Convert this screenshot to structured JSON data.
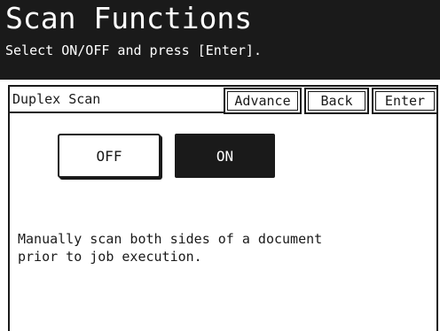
{
  "header": {
    "title": "Scan Functions",
    "subtitle": "Select ON/OFF and press [Enter]."
  },
  "panel": {
    "title": "Duplex Scan",
    "buttons": {
      "advance": "Advance",
      "back": "Back",
      "enter": "Enter"
    },
    "options": {
      "off": "OFF",
      "on": "ON",
      "selected": "ON"
    },
    "description_line1": "Manually scan both sides of a document",
    "description_line2": "prior to job execution."
  },
  "colors": {
    "background": "#ffffff",
    "foreground": "#1a1a1a",
    "header_background": "#1a1a1a",
    "selected_option": "#1a1a1a"
  }
}
